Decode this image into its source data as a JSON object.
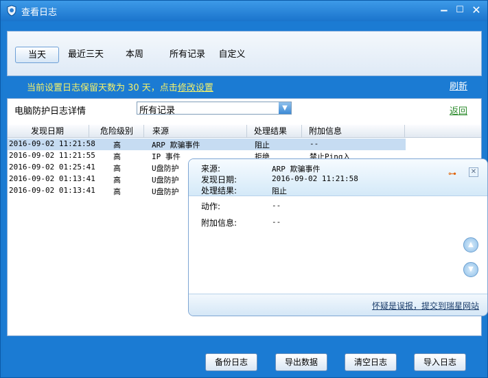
{
  "window": {
    "title": "查看日志"
  },
  "tabs": [
    "当天",
    "最近三天",
    "本周",
    "所有记录",
    "自定义"
  ],
  "notice": {
    "text": "当前设置日志保留天数为 30 天，点击",
    "link": "修改设置"
  },
  "refresh_label": "刷新",
  "panel": {
    "title": "电脑防护日志详情",
    "filter_value": "所有记录",
    "back_label": "返回"
  },
  "table": {
    "columns": [
      "发现日期",
      "危险级别",
      "来源",
      "处理结果",
      "附加信息"
    ],
    "rows": [
      [
        "2016-09-02 11:21:58",
        "高",
        "ARP 欺骗事件",
        "阻止",
        "--"
      ],
      [
        "2016-09-02 11:21:55",
        "高",
        "IP 事件",
        "拒绝",
        "禁止Ping入"
      ],
      [
        "2016-09-02 01:25:41",
        "高",
        "U盘防护",
        "",
        ""
      ],
      [
        "2016-09-02 01:13:41",
        "高",
        "U盘防护",
        "",
        ""
      ],
      [
        "2016-09-02 01:13:41",
        "高",
        "U盘防护",
        "",
        ""
      ]
    ]
  },
  "detail": {
    "source_label": "来源:",
    "source_value": "ARP 欺骗事件",
    "date_label": "发现日期:",
    "date_value": "2016-09-02 11:21:58",
    "result_label": "处理结果:",
    "result_value": "阻止",
    "action_label": "动作:",
    "action_value": "--",
    "extra_label": "附加信息:",
    "extra_value": "--",
    "report_link": "怀疑是误报，提交到瑞星网站"
  },
  "buttons": {
    "backup": "备份日志",
    "export": "导出数据",
    "clear": "清空日志",
    "import": "导入日志"
  },
  "colors": {
    "window_blue": "#1b7bd3",
    "notice_yellow": "#f5f26a",
    "back_green": "#2a8a2a"
  }
}
